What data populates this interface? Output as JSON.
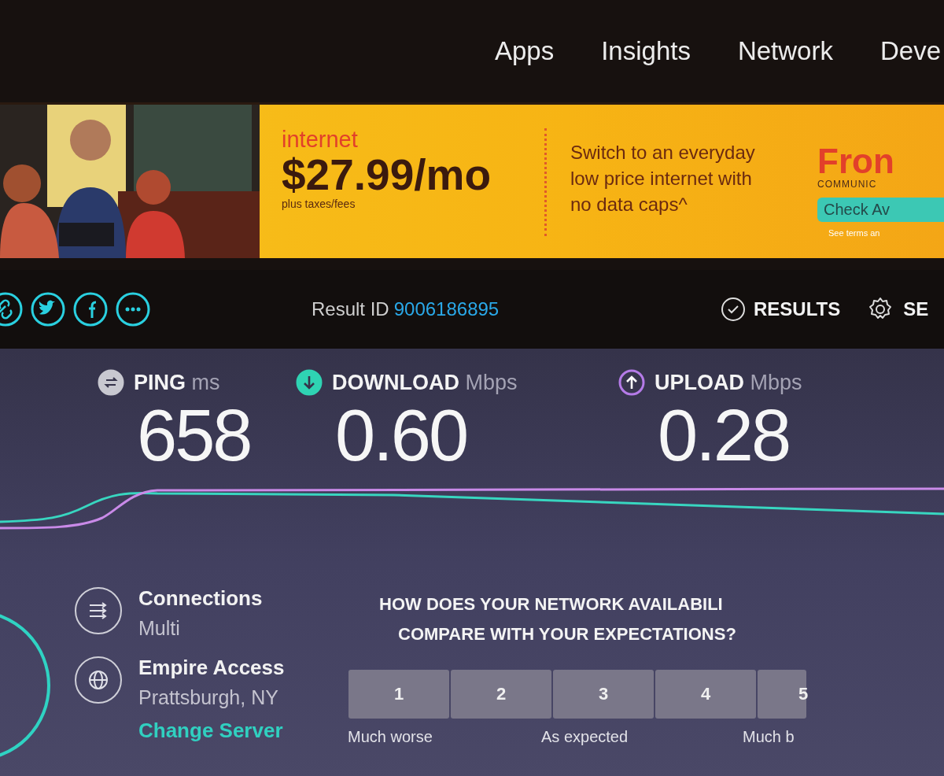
{
  "nav": {
    "items": [
      "Apps",
      "Insights",
      "Network",
      "Deve"
    ]
  },
  "ad": {
    "kicker": "internet",
    "price": "$27.99/mo",
    "fine_print": "plus taxes/fees",
    "message": "Switch to an everyday low price internet with no data caps^",
    "brand": "Fron",
    "brand_sub": "COMMUNIC",
    "cta": "Check Av",
    "terms": "See terms an"
  },
  "result_bar": {
    "share": [
      {
        "kind": "link"
      },
      {
        "kind": "twitter"
      },
      {
        "kind": "facebook"
      },
      {
        "kind": "more"
      }
    ],
    "result_label": "Result ID",
    "result_id": "9006186895",
    "results": "RESULTS",
    "settings": "SE"
  },
  "metrics": [
    {
      "kind": "ping",
      "label": "PING",
      "unit": "ms",
      "value": "658"
    },
    {
      "kind": "download",
      "label": "DOWNLOAD",
      "unit": "Mbps",
      "value": "0.60"
    },
    {
      "kind": "upload",
      "label": "UPLOAD",
      "unit": "Mbps",
      "value": "0.28"
    }
  ],
  "details": [
    {
      "kind": "connections",
      "title": "Connections",
      "value": "Multi"
    },
    {
      "kind": "server",
      "title": "Empire Access",
      "value": "Prattsburgh, NY",
      "link": "Change Server"
    }
  ],
  "survey": {
    "question": [
      "HOW DOES YOUR NETWORK AVAILABILI",
      "COMPARE WITH YOUR EXPECTATIONS?"
    ],
    "options": [
      "1",
      "2",
      "3",
      "4",
      "5"
    ],
    "scale_labels": [
      "Much worse",
      "As expected",
      "Much b"
    ]
  }
}
